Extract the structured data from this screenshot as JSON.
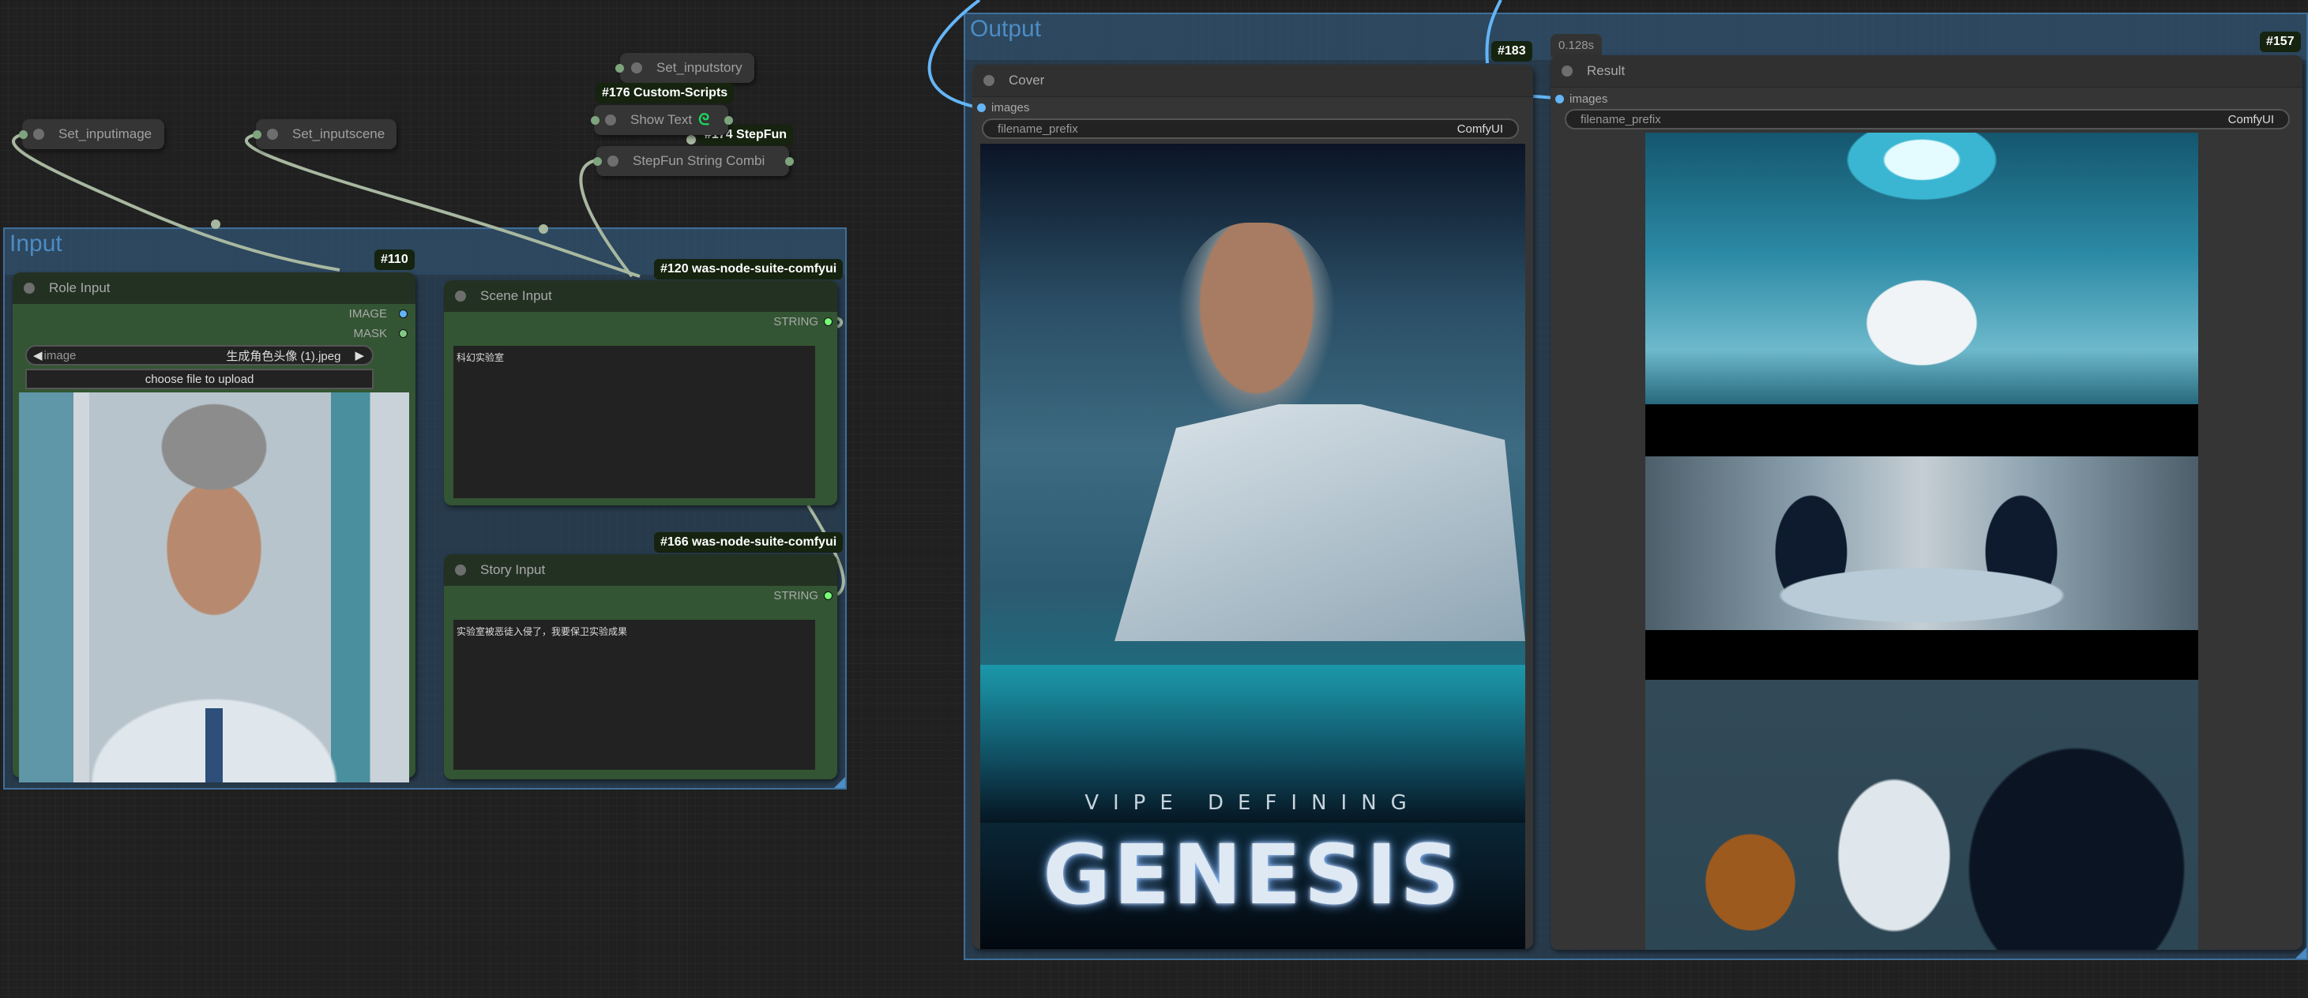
{
  "canvas": {
    "floating_nodes": [
      {
        "id": "set-inputimage",
        "title": "Set_inputimage"
      },
      {
        "id": "set-inputscene",
        "title": "Set_inputscene"
      },
      {
        "id": "set-inputstory",
        "title": "Set_inputstory"
      },
      {
        "id": "show-text",
        "title": "Show Text",
        "badge": "#176 Custom-Scripts",
        "icon": "custom-scripts-snake-icon"
      },
      {
        "id": "stepfun-string-combi",
        "title": "StepFun String Combi",
        "badge": "#174 StepFun"
      }
    ]
  },
  "groups": {
    "input": {
      "title": "Input",
      "nodes": {
        "role_input": {
          "badge": "#110",
          "title": "Role Input",
          "outputs": [
            "IMAGE",
            "MASK"
          ],
          "image_combo": {
            "label": "image",
            "value": "生成角色头像 (1).jpeg"
          },
          "upload_label": "choose file to upload",
          "preview": "portrait-grey-haired-scientist"
        },
        "scene_input": {
          "badge": "#120 was-node-suite-comfyui",
          "title": "Scene Input",
          "output": "STRING",
          "text": "科幻实验室"
        },
        "story_input": {
          "badge": "#166 was-node-suite-comfyui",
          "title": "Story Input",
          "output": "STRING",
          "text": "实验室被恶徒入侵了，我要保卫实验成果"
        }
      }
    },
    "output": {
      "title": "Output",
      "nodes": {
        "cover": {
          "badge": "#183",
          "title": "Cover",
          "input": "images",
          "filename_prefix_label": "filename_prefix",
          "filename_prefix_value": "ComfyUI",
          "poster_tagline": "VIPE DEFINING",
          "poster_title": "GENESIS"
        },
        "result": {
          "badge": "#157",
          "exec_time": "0.128s",
          "title": "Result",
          "input": "images",
          "filename_prefix_label": "filename_prefix",
          "filename_prefix_value": "ComfyUI",
          "frames": [
            "scientist-in-sci-fi-lab",
            "masked-intruders-fight",
            "scientist-confronts-intruder"
          ]
        }
      }
    }
  },
  "colors": {
    "image_slot": "#64b5f6",
    "mask_slot": "#81c784",
    "string_slot": "#77ff77",
    "wire_default": "#a8b8a0",
    "wire_image": "#64b5f6",
    "group_border": "#3f6f9a"
  }
}
